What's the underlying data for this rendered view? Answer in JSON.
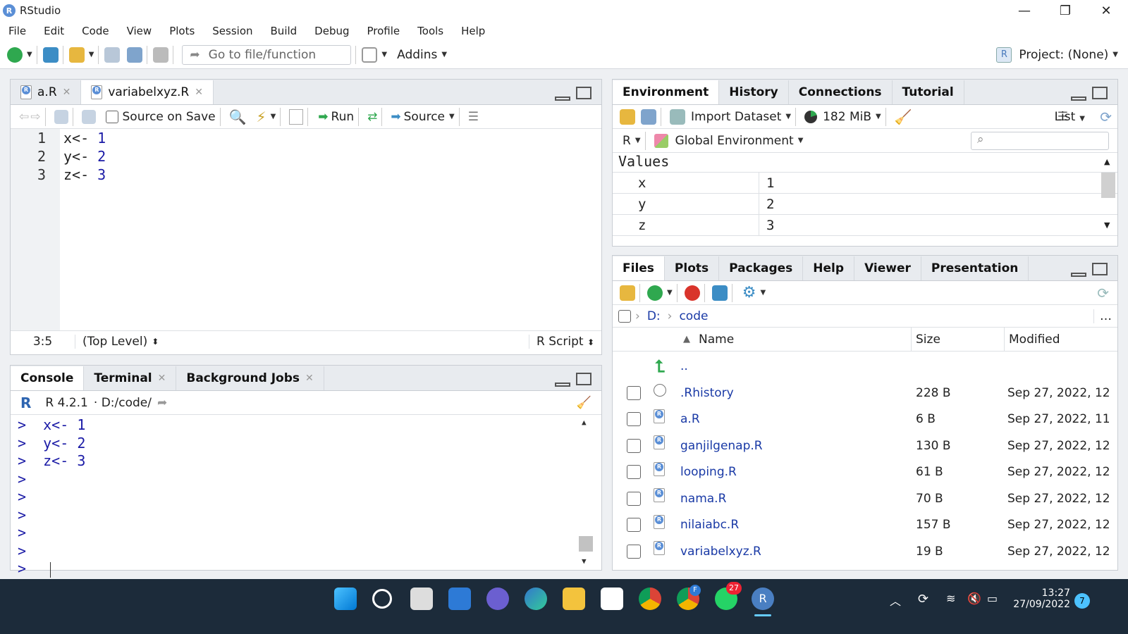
{
  "app": {
    "title": "RStudio",
    "logo": "R"
  },
  "menu": [
    "File",
    "Edit",
    "Code",
    "View",
    "Plots",
    "Session",
    "Build",
    "Debug",
    "Profile",
    "Tools",
    "Help"
  ],
  "toolbar": {
    "goto_placeholder": "Go to file/function",
    "addins": "Addins",
    "project": "Project: (None)"
  },
  "editor": {
    "tabs": [
      {
        "label": "a.R"
      },
      {
        "label": "variabelxyz.R"
      }
    ],
    "source_on_save": "Source on Save",
    "run": "Run",
    "source": "Source",
    "lines": [
      {
        "n": "1",
        "code": "x<- ",
        "num": "1"
      },
      {
        "n": "2",
        "code": "y<- ",
        "num": "2"
      },
      {
        "n": "3",
        "code": "z<- ",
        "num": "3"
      }
    ],
    "status": {
      "pos": "3:5",
      "scope": "(Top Level)",
      "type": "R Script"
    }
  },
  "console": {
    "tabs": [
      "Console",
      "Terminal",
      "Background Jobs"
    ],
    "version": "R 4.2.1",
    "path": "· D:/code/",
    "lines": [
      {
        "p": ">",
        "c": "x<- ",
        "n": "1"
      },
      {
        "p": ">",
        "c": "y<- ",
        "n": "2"
      },
      {
        "p": ">",
        "c": "z<- ",
        "n": "3"
      },
      {
        "p": ">",
        "c": "",
        "n": ""
      },
      {
        "p": ">",
        "c": "",
        "n": ""
      },
      {
        "p": ">",
        "c": "",
        "n": ""
      },
      {
        "p": ">",
        "c": "",
        "n": ""
      },
      {
        "p": ">",
        "c": "",
        "n": ""
      },
      {
        "p": ">",
        "c": "",
        "n": ""
      }
    ]
  },
  "env": {
    "tabs": [
      "Environment",
      "History",
      "Connections",
      "Tutorial"
    ],
    "import": "Import Dataset",
    "memory": "182 MiB",
    "list": "List",
    "lang": "R",
    "scope": "Global Environment",
    "section": "Values",
    "rows": [
      {
        "name": "x",
        "value": "1"
      },
      {
        "name": "y",
        "value": "2"
      },
      {
        "name": "z",
        "value": "3"
      }
    ]
  },
  "files": {
    "tabs": [
      "Files",
      "Plots",
      "Packages",
      "Help",
      "Viewer",
      "Presentation"
    ],
    "crumb": {
      "drive": "D:",
      "dir": "code"
    },
    "cols": {
      "name": "Name",
      "size": "Size",
      "modified": "Modified"
    },
    "up": "..",
    "rows": [
      {
        "name": ".Rhistory",
        "size": "228 B",
        "modified": "Sep 27, 2022, 12",
        "icon": "history-icon"
      },
      {
        "name": "a.R",
        "size": "6 B",
        "modified": "Sep 27, 2022, 11",
        "icon": "r-file-icon"
      },
      {
        "name": "ganjilgenap.R",
        "size": "130 B",
        "modified": "Sep 27, 2022, 12",
        "icon": "r-file-icon"
      },
      {
        "name": "looping.R",
        "size": "61 B",
        "modified": "Sep 27, 2022, 12",
        "icon": "r-file-icon"
      },
      {
        "name": "nama.R",
        "size": "70 B",
        "modified": "Sep 27, 2022, 12",
        "icon": "r-file-icon"
      },
      {
        "name": "nilaiabc.R",
        "size": "157 B",
        "modified": "Sep 27, 2022, 12",
        "icon": "r-file-icon"
      },
      {
        "name": "variabelxyz.R",
        "size": "19 B",
        "modified": "Sep 27, 2022, 12",
        "icon": "r-file-icon"
      }
    ]
  },
  "taskbar": {
    "time": "13:27",
    "date": "27/09/2022",
    "whatsapp_badge": "27",
    "notif": "7",
    "chrome_profile": "F"
  }
}
